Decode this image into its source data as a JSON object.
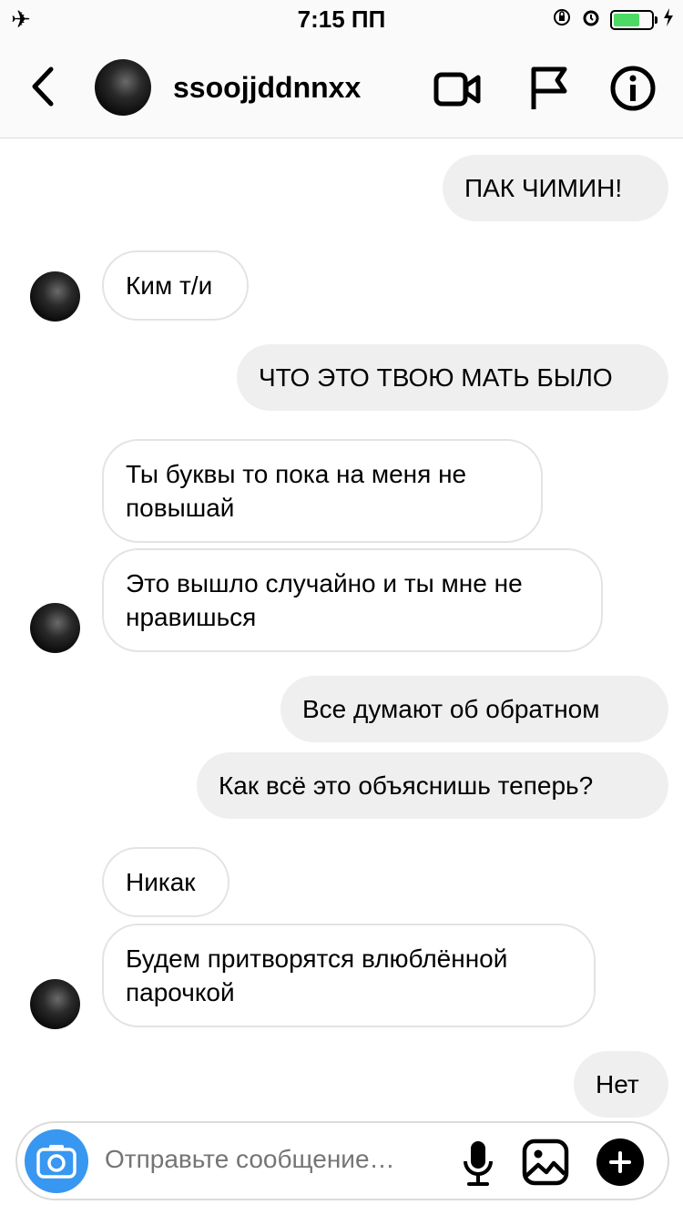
{
  "status_bar": {
    "time": "7:15 ПП",
    "icons": [
      "airplane-icon",
      "orientation-lock-icon",
      "alarm-icon",
      "battery-icon",
      "charging-icon"
    ],
    "battery_color": "#4cd964"
  },
  "header": {
    "username": "ssoojjddnnxx",
    "icons": [
      "back-icon",
      "video-call-icon",
      "flag-icon",
      "info-icon"
    ]
  },
  "messages": [
    {
      "side": "out",
      "text": "ПАК ЧИМИН!"
    },
    {
      "side": "in",
      "text": "Ким т/и"
    },
    {
      "side": "out",
      "text": "ЧТО ЭТО ТВОЮ МАТЬ БЫЛО"
    },
    {
      "side": "in",
      "text": "Ты буквы то пока на меня не повышай"
    },
    {
      "side": "in",
      "text": "Это вышло случайно и ты мне не нравишься"
    },
    {
      "side": "out",
      "text": "Все думают об обратном"
    },
    {
      "side": "out",
      "text": "Как всё это объяснишь теперь?"
    },
    {
      "side": "in",
      "text": "Никак"
    },
    {
      "side": "in",
      "text": "Будем притворятся влюблённой парочкой"
    },
    {
      "side": "out",
      "text": "Нет"
    }
  ],
  "composer": {
    "placeholder": "Отправьте сообщение…",
    "accent_color": "#3897f0",
    "icons": [
      "camera-icon",
      "microphone-icon",
      "gallery-icon",
      "plus-icon"
    ]
  }
}
